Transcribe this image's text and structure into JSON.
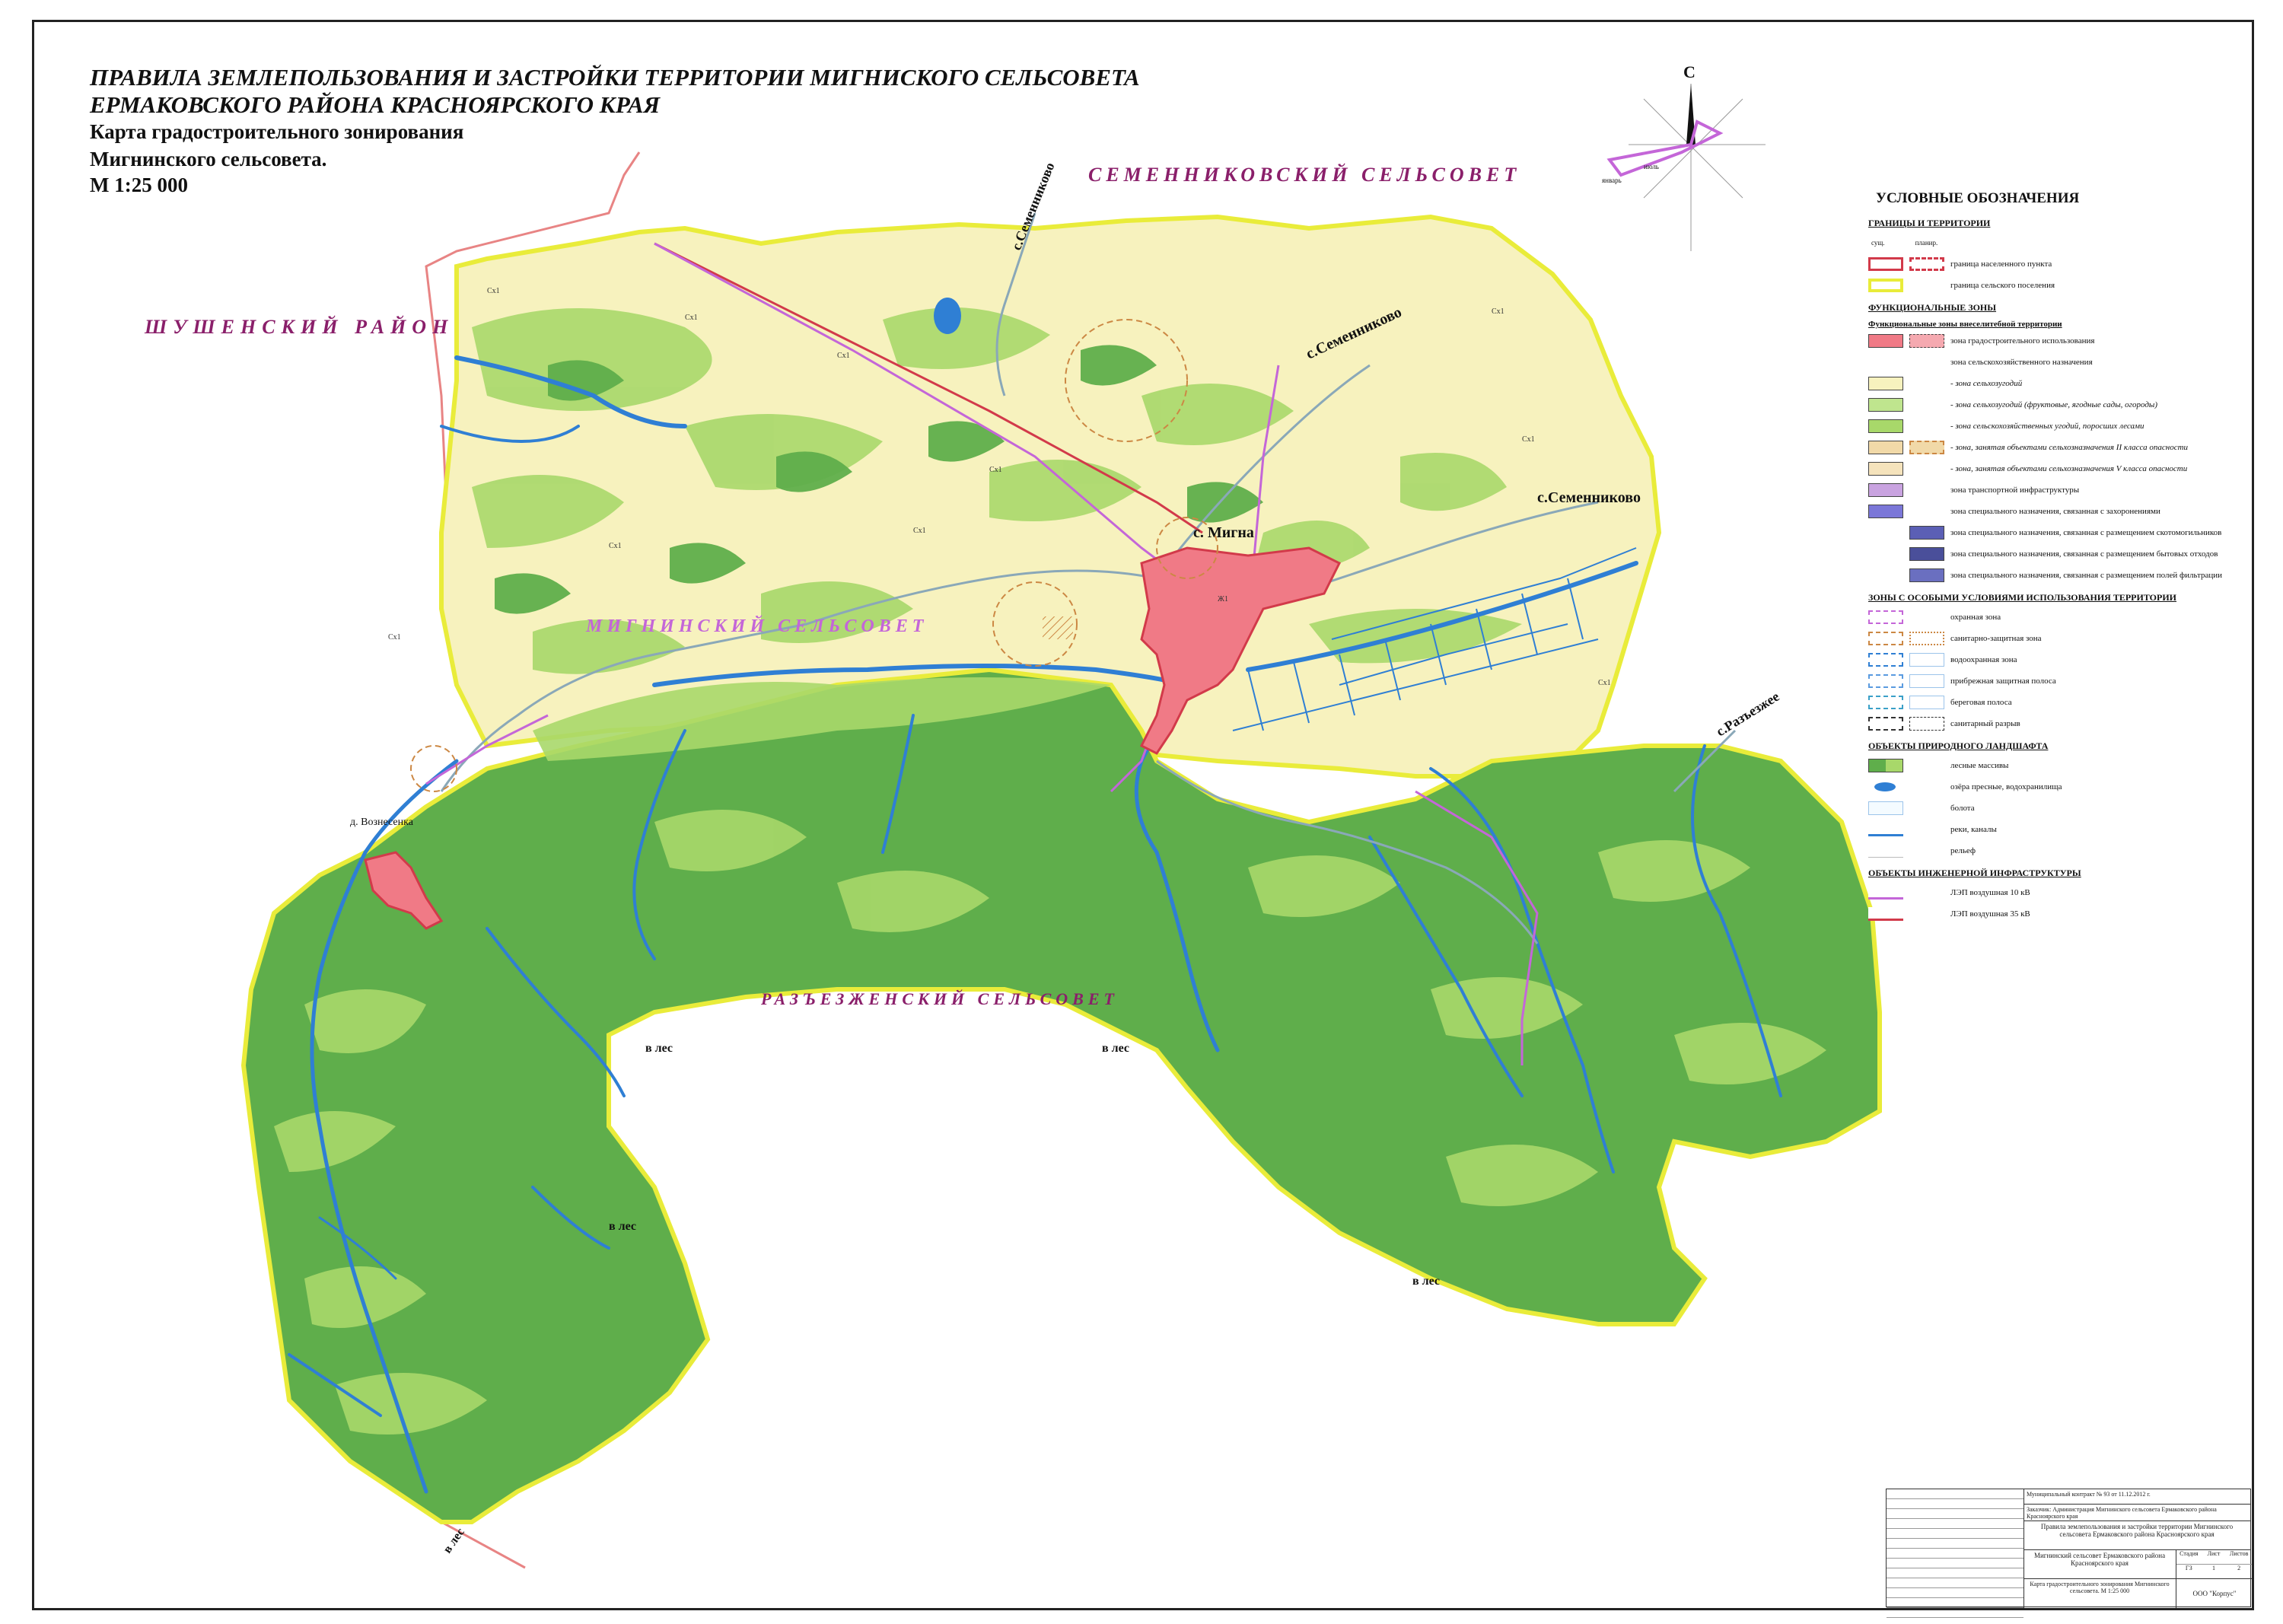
{
  "title": {
    "line1": "ПРАВИЛА ЗЕМЛЕПОЛЬЗОВАНИЯ И ЗАСТРОЙКИ ТЕРРИТОРИИ МИГНИСКОГО СЕЛЬСОВЕТА",
    "line2": "ЕРМАКОВСКОГО РАЙОНА КРАСНОЯРСКОГО КРАЯ",
    "line3": "Карта градостроительного зонирования",
    "line4": "Мигнинского сельсовета.",
    "scale": "М 1:25 000"
  },
  "compass": {
    "north": "С",
    "label_jan": "январь",
    "label_jul": "июль"
  },
  "regions": {
    "semennikovsky": "СЕМЕННИКОВСКИЙ СЕЛЬСОВЕТ",
    "shushensky": "ШУШЕНСКИЙ РАЙОН",
    "mignisky": "МИГНИНСКИЙ СЕЛЬСОВЕТ",
    "razezzhensky": "РАЗЪЕЗЖЕНСКИЙ СЕЛЬСОВЕТ"
  },
  "places": {
    "migna": "с. Мигна",
    "voznesenka": "д. Вознесенка",
    "semennikovo_1": "с.Семенниково",
    "semennikovo_2": "с.Семенниково",
    "semennikovo_3": "с.Семенниково",
    "razezzhee": "с.Разъезжее",
    "forest_1": "в лес",
    "forest_2": "в лес",
    "forest_3": "в лес",
    "forest_4": "в лес",
    "forest_5": "в лес"
  },
  "zone_codes": {
    "agri": "Сх1",
    "settlement": "Ж1"
  },
  "colors": {
    "forest": "#5fae4b",
    "forest_light": "#a8d86a",
    "agri": "#f7f2be",
    "settlement": "#f07a86",
    "water": "#2f7fd4",
    "boundary": "#e9ec3a",
    "power10": "#c466d8",
    "power35": "#d23a4a",
    "outer": "#e88484"
  },
  "legend": {
    "title": "УСЛОВНЫЕ ОБОЗНАЧЕНИЯ",
    "sec_boundaries": "ГРАНИЦЫ И ТЕРРИТОРИИ",
    "col_existing": "сущ.",
    "col_planned": "планир.",
    "settlement_border": "граница населенного пункта",
    "rural_border": "граница сельского поселения",
    "sec_functional": "ФУНКЦИОНАЛЬНЫЕ ЗОНЫ",
    "sub_functional": "Функциональные зоны внеселитебной территории",
    "urban_use": "зона градостроительного использования",
    "agri_purpose": "зона сельскохозяйственного назначения",
    "agri_land": "- зона сельхозугодий",
    "agri_land_orchard": "- зона сельхозугодий (фруктовые, ягодные сады, огороды)",
    "agri_overgrown": "- зона сельскохозяйственных угодий, поросших лесами",
    "agri_class2": "- зона, занятая объектами сельхозназначения II класса опасности",
    "agri_class5": "- зона, занятая объектами сельхозназначения V класса опасности",
    "transport": "зона транспортной инфраструктуры",
    "burial": "зона специального назначения, связанная с захоронениями",
    "cattle_burial": "зона специального назначения, связанная с размещением скотомогильников",
    "waste": "зона специального назначения, связанная с размещением бытовых отходов",
    "filtration": "зона специального назначения, связанная с размещением полей фильтрации",
    "sec_special": "ЗОНЫ С ОСОБЫМИ УСЛОВИЯМИ ИСПОЛЬЗОВАНИЯ ТЕРРИТОРИИ",
    "protection": "охранная зона",
    "sanitary": "санитарно-защитная зона",
    "water_protection": "водоохранная зона",
    "coastal_strip": "прибрежная защитная полоса",
    "shore_strip": "береговая полоса",
    "sanitary_gap": "санитарный разрыв",
    "sec_landscape": "ОБЪЕКТЫ ПРИРОДНОГО ЛАНДШАФТА",
    "forests": "лесные массивы",
    "lakes": "озёра пресные, водохранилища",
    "swamps": "болота",
    "rivers": "реки, каналы",
    "relief": "рельеф",
    "sec_engineering": "ОБЪЕКТЫ ИНЖЕНЕРНОЙ ИНФРАСТРУКТУРЫ",
    "power_10kv": "ЛЭП воздушная 10 кВ",
    "power_35kv": "ЛЭП воздушная 35 кВ"
  },
  "stamp": {
    "row1": "Муниципальный контракт № 93 от 11.12.2012 г.",
    "row2": "Заказчик: Администрация Мигнинского сельсовета Ермаковского района Красноярского края",
    "row3": "Правила землепользования и застройки территории Мигнинского сельсовета Ермаковского района Красноярского края",
    "row4": "Мигнинский сельсовет Ермаковского района Красноярского края",
    "row5": "Карта градостроительного зонирования Мигнинского сельсовета. М 1:25 000",
    "org": "ООО \"Корпус\"",
    "stage_label": "Стадия",
    "sheet_label": "Лист",
    "sheets_label": "Листов",
    "stage": "ГЗ",
    "sheet": "1",
    "sheets": "2"
  }
}
